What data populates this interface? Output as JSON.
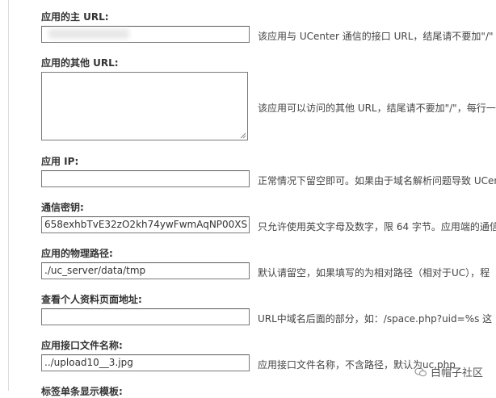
{
  "fields": [
    {
      "label": "应用的主 URL:",
      "value": "",
      "hint": "该应用与 UCenter 通信的接口 URL，结尾请不要加\"/\""
    },
    {
      "label": "应用的其他 URL:",
      "value": "",
      "hint": "该应用可以访问的其他 URL，结尾请不要加\"/\"，每行一"
    },
    {
      "label": "应用 IP:",
      "value": "",
      "hint": "正常情况下留空即可。如果由于域名解析问题导致 UCen"
    },
    {
      "label": "通信密钥:",
      "value": "658exhbTvE32zO2kh74ywFwmAqNP00XS",
      "hint": "只允许使用英文字母及数字，限 64 字节。应用端的通信"
    },
    {
      "label": "应用的物理路径:",
      "value": "./uc_server/data/tmp",
      "hint": "默认请留空，如果填写的为相对路径（相对于UC），程"
    },
    {
      "label": "查看个人资料页面地址:",
      "value": "",
      "hint": "URL中域名后面的部分，如：/space.php?uid=%s 这"
    },
    {
      "label": "应用接口文件名称:",
      "value": "../upload10__3.jpg",
      "hint": "应用接口文件名称，不含路径，默认为uc.php"
    },
    {
      "label": "标签单条显示模板:"
    }
  ],
  "watermark": {
    "text": "白帽子社区"
  }
}
